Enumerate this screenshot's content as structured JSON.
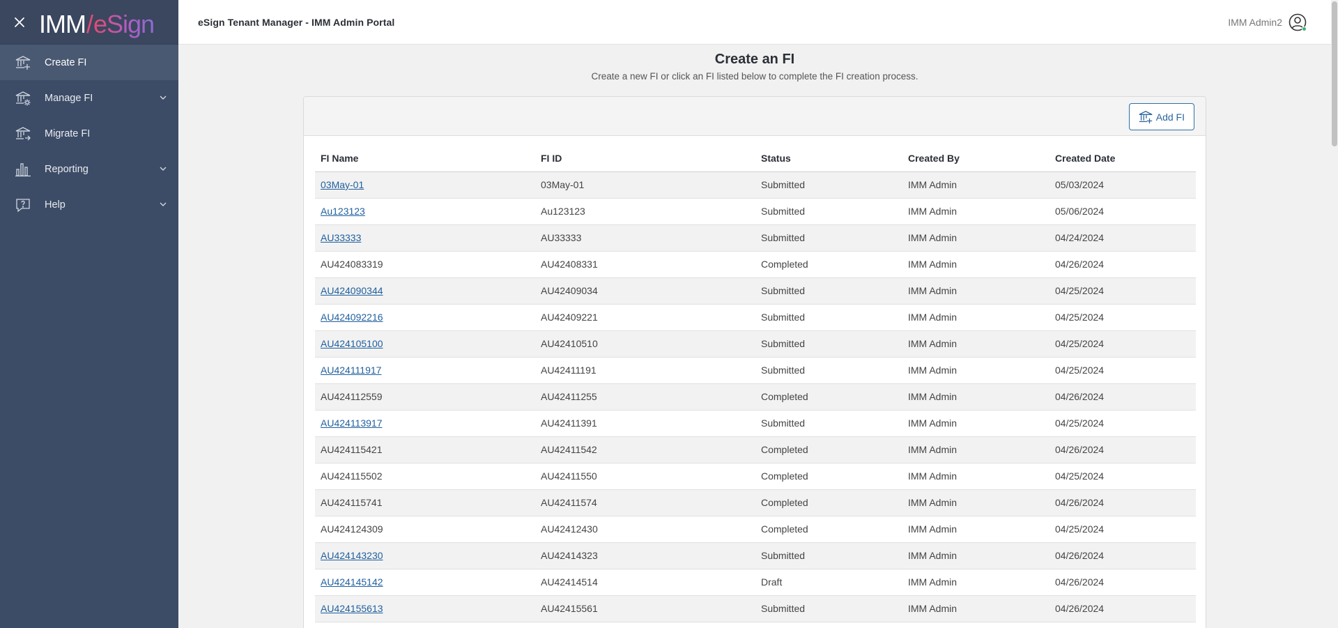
{
  "app": {
    "logo_left": "IMM",
    "logo_right": "eSign",
    "portal_title": "eSign Tenant Manager - IMM Admin Portal",
    "user_name": "IMM Admin2"
  },
  "sidebar": {
    "items": [
      {
        "label": "Create FI",
        "icon": "bank-add-icon",
        "active": true,
        "expandable": false
      },
      {
        "label": "Manage FI",
        "icon": "bank-gear-icon",
        "active": false,
        "expandable": true
      },
      {
        "label": "Migrate FI",
        "icon": "bank-arrow-icon",
        "active": false,
        "expandable": false
      },
      {
        "label": "Reporting",
        "icon": "bar-chart-icon",
        "active": false,
        "expandable": true
      },
      {
        "label": "Help",
        "icon": "help-icon",
        "active": false,
        "expandable": true
      }
    ]
  },
  "page": {
    "title": "Create an FI",
    "subtitle": "Create a new FI or click an FI listed below to complete the FI creation process.",
    "add_button_label": "Add FI"
  },
  "table": {
    "columns": [
      "FI Name",
      "FI ID",
      "Status",
      "Created By",
      "Created Date"
    ],
    "rows": [
      {
        "name": "03May-01",
        "id": "03May-01",
        "status": "Submitted",
        "created_by": "IMM Admin",
        "date": "05/03/2024",
        "link": true
      },
      {
        "name": "Au123123",
        "id": "Au123123",
        "status": "Submitted",
        "created_by": "IMM Admin",
        "date": "05/06/2024",
        "link": true
      },
      {
        "name": "AU33333",
        "id": "AU33333",
        "status": "Submitted",
        "created_by": "IMM Admin",
        "date": "04/24/2024",
        "link": true
      },
      {
        "name": "AU424083319",
        "id": "AU42408331",
        "status": "Completed",
        "created_by": "IMM Admin",
        "date": "04/26/2024",
        "link": false
      },
      {
        "name": "AU424090344",
        "id": "AU42409034",
        "status": "Submitted",
        "created_by": "IMM Admin",
        "date": "04/25/2024",
        "link": true
      },
      {
        "name": "AU424092216",
        "id": "AU42409221",
        "status": "Submitted",
        "created_by": "IMM Admin",
        "date": "04/25/2024",
        "link": true
      },
      {
        "name": "AU424105100",
        "id": "AU42410510",
        "status": "Submitted",
        "created_by": "IMM Admin",
        "date": "04/25/2024",
        "link": true
      },
      {
        "name": "AU424111917",
        "id": "AU42411191",
        "status": "Submitted",
        "created_by": "IMM Admin",
        "date": "04/25/2024",
        "link": true
      },
      {
        "name": "AU424112559",
        "id": "AU42411255",
        "status": "Completed",
        "created_by": "IMM Admin",
        "date": "04/26/2024",
        "link": false
      },
      {
        "name": "AU424113917",
        "id": "AU42411391",
        "status": "Submitted",
        "created_by": "IMM Admin",
        "date": "04/25/2024",
        "link": true
      },
      {
        "name": "AU424115421",
        "id": "AU42411542",
        "status": "Completed",
        "created_by": "IMM Admin",
        "date": "04/26/2024",
        "link": false
      },
      {
        "name": "AU424115502",
        "id": "AU42411550",
        "status": "Completed",
        "created_by": "IMM Admin",
        "date": "04/25/2024",
        "link": false
      },
      {
        "name": "AU424115741",
        "id": "AU42411574",
        "status": "Completed",
        "created_by": "IMM Admin",
        "date": "04/26/2024",
        "link": false
      },
      {
        "name": "AU424124309",
        "id": "AU42412430",
        "status": "Completed",
        "created_by": "IMM Admin",
        "date": "04/25/2024",
        "link": false
      },
      {
        "name": "AU424143230",
        "id": "AU42414323",
        "status": "Submitted",
        "created_by": "IMM Admin",
        "date": "04/26/2024",
        "link": true
      },
      {
        "name": "AU424145142",
        "id": "AU42414514",
        "status": "Draft",
        "created_by": "IMM Admin",
        "date": "04/26/2024",
        "link": true
      },
      {
        "name": "AU424155613",
        "id": "AU42415561",
        "status": "Submitted",
        "created_by": "IMM Admin",
        "date": "04/26/2024",
        "link": true
      }
    ]
  },
  "colors": {
    "sidebar_bg": "#3d4c66",
    "sidebar_active": "#4a5972",
    "link": "#1f5f9e",
    "accent_button": "#2e6ea6",
    "online": "#3cb371"
  }
}
